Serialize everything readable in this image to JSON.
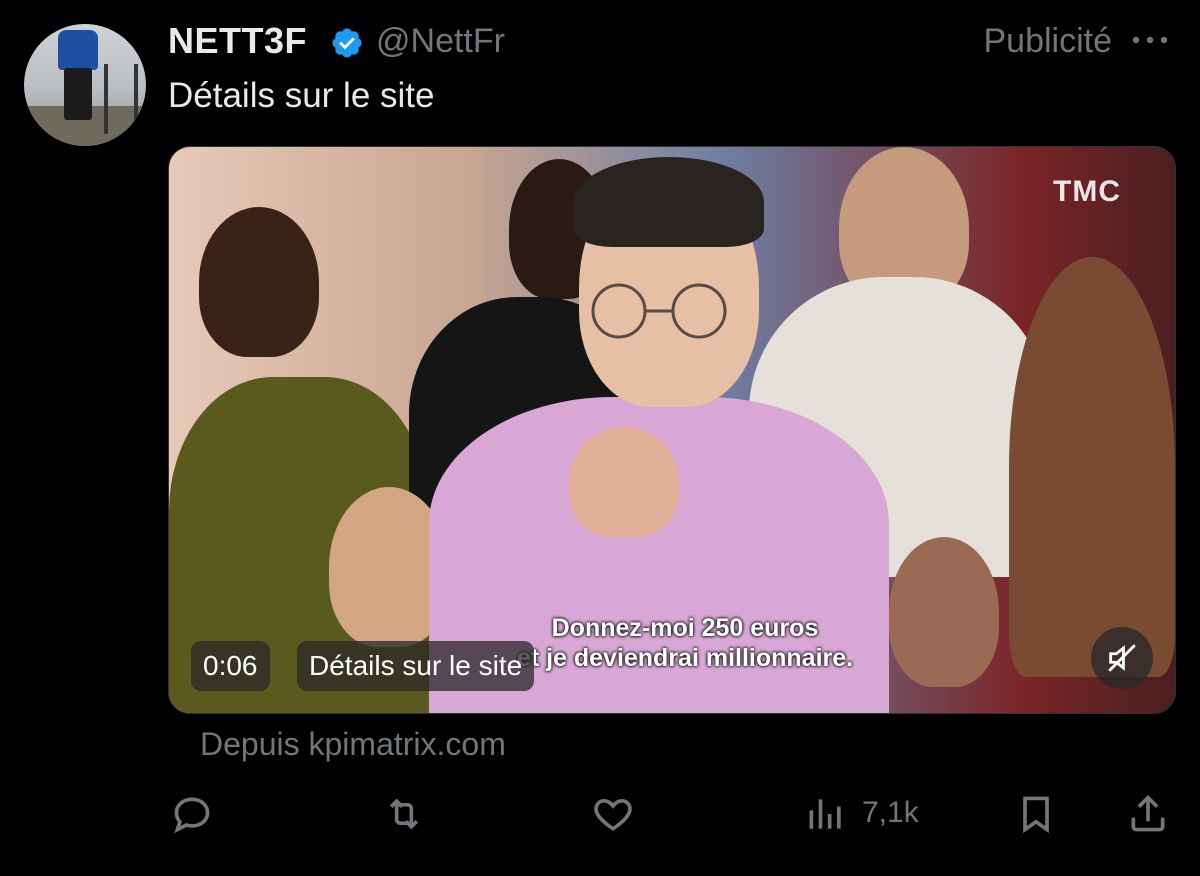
{
  "tweet": {
    "display_name": "NETT3F",
    "handle": "@NettFr",
    "promoted_label": "Publicité",
    "text": "Détails sur le site",
    "source_label": "Depuis kpimatrix.com"
  },
  "media": {
    "channel_logo": "TMC",
    "subtitle": "Donnez-moi 250 euros\net je deviendrai millionnaire.",
    "timestamp": "0:06",
    "link_label": "Détails sur le site",
    "mute_icon": "muted-speaker-icon"
  },
  "actions": {
    "reply_icon": "reply-icon",
    "retweet_icon": "retweet-icon",
    "like_icon": "heart-icon",
    "views_icon": "views-bar-chart-icon",
    "views_count": "7,1k",
    "bookmark_icon": "bookmark-icon",
    "share_icon": "share-icon"
  },
  "colors": {
    "background": "#000000",
    "primary_text": "#e7e9ea",
    "secondary_text": "#71767b",
    "verified_badge": "#1d9bf0"
  }
}
